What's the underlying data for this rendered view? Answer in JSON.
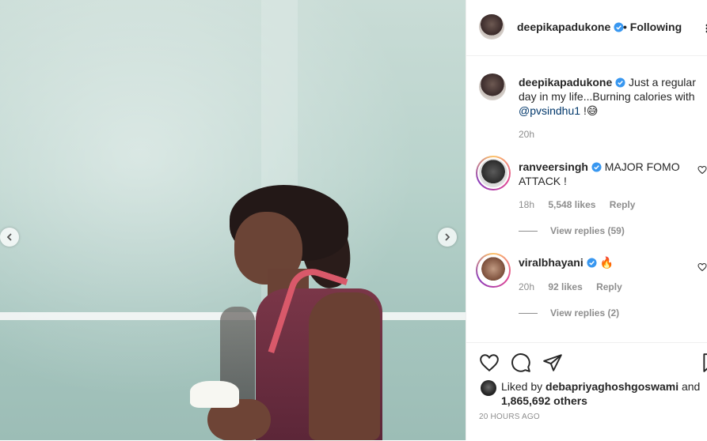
{
  "post": {
    "author": "deepikapadukone",
    "follow_label": "Following",
    "follow_separator": "•",
    "caption": "Just a regular day in my life...Burning calories with",
    "caption_mention": "@pvsindhu1",
    "caption_suffix": "!",
    "caption_emoji": "😅",
    "caption_time": "20h",
    "likes_prefix": "Liked by",
    "likes_user": "debapriyaghoshgoswami",
    "likes_and": "and",
    "likes_count": "1,865,692 others",
    "timestamp": "20 HOURS AGO"
  },
  "comments": [
    {
      "user": "ranveersingh",
      "text": "MAJOR FOMO ATTACK !",
      "time": "18h",
      "likes": "5,548 likes",
      "reply": "Reply",
      "view_replies": "View replies (59)"
    },
    {
      "user": "viralbhayani",
      "text": "🔥",
      "time": "20h",
      "likes": "92 likes",
      "reply": "Reply",
      "view_replies": "View replies (2)"
    }
  ],
  "icons": {
    "verified": "verified-badge-icon",
    "more": "more-options-icon",
    "like": "heart-icon",
    "comment": "comment-icon",
    "share": "share-icon",
    "save": "bookmark-icon",
    "prev": "chevron-left-icon",
    "next": "chevron-right-icon"
  },
  "colors": {
    "verified": "#3897f0",
    "muted": "#8e8e8e",
    "text": "#262626",
    "mention": "#00376b"
  }
}
